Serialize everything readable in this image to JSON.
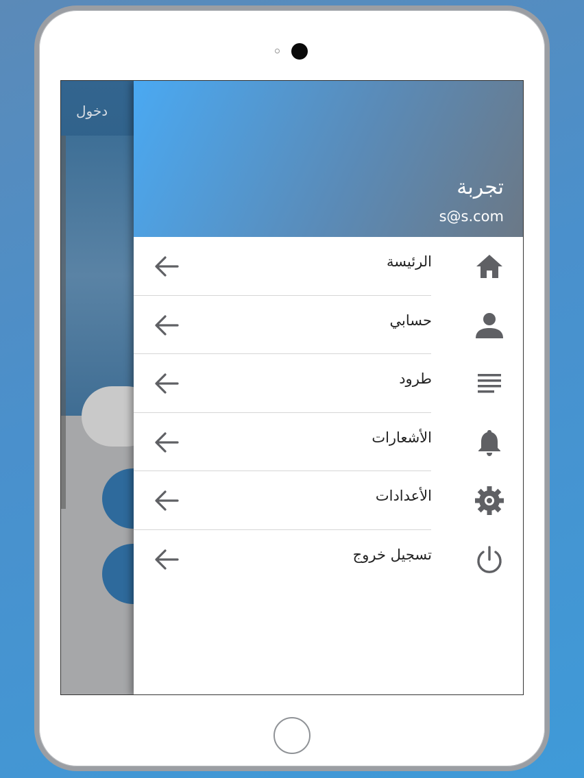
{
  "background_app": {
    "login_label": "دخول"
  },
  "drawer": {
    "user": {
      "name": "تجربة",
      "email": "s@s.com"
    },
    "items": [
      {
        "label": "الرئيسة",
        "icon": "home-icon"
      },
      {
        "label": "حسابي",
        "icon": "person-icon"
      },
      {
        "label": "طرود",
        "icon": "list-icon"
      },
      {
        "label": "الأشعارات",
        "icon": "bell-icon"
      },
      {
        "label": "الأعدادات",
        "icon": "gear-icon"
      },
      {
        "label": "تسجيل خروج",
        "icon": "power-icon"
      }
    ]
  },
  "colors": {
    "header_start": "#4aa9f2",
    "header_end": "#6b7886",
    "icon_gray": "#5f6064",
    "text_dark": "#222222"
  }
}
